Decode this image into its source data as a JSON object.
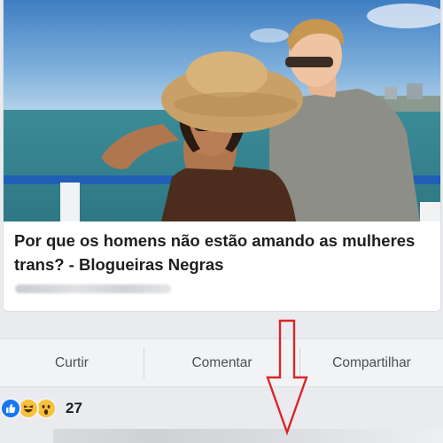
{
  "post": {
    "title": "Por que os homens não estão amando as mulheres trans? - Blogueiras Negras"
  },
  "actions": {
    "like_label": "Curtir",
    "comment_label": "Comentar",
    "share_label": "Compartilhar"
  },
  "reactions": {
    "icons": [
      "like-icon",
      "haha-icon",
      "wow-icon"
    ],
    "count": "27"
  },
  "annotation": {
    "arrow_color": "#d8262b",
    "arrow_direction": "down"
  },
  "colors": {
    "like_blue": "#1877f2",
    "emoji_yellow": "#f7c13c"
  }
}
